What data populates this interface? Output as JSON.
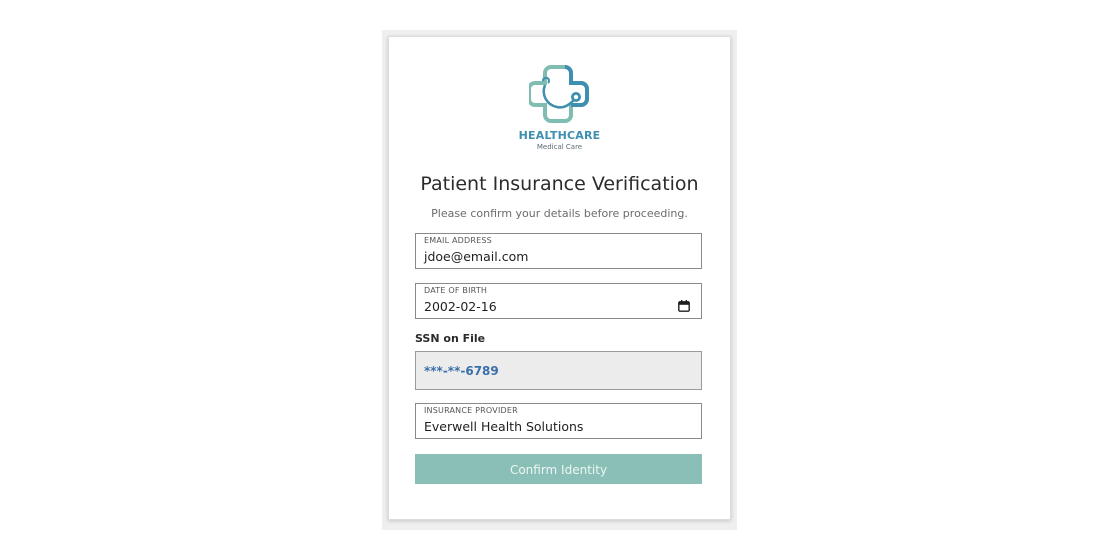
{
  "brand": {
    "name": "HEALTHCARE",
    "tagline": "Medical Care",
    "primary_color": "#3f8fb0",
    "secondary_color": "#7fbdb2",
    "logo_icon": "medical-cross-stethoscope-icon"
  },
  "form": {
    "title": "Patient Insurance Verification",
    "subtitle": "Please confirm your details before proceeding.",
    "email": {
      "label": "EMAIL ADDRESS",
      "value": "jdoe@email.com"
    },
    "dob": {
      "label": "DATE OF BIRTH",
      "value": "2002-02-16",
      "icon": "calendar-icon"
    },
    "ssn": {
      "label": "SSN on File",
      "value": "***-**-6789"
    },
    "insurance": {
      "label": "INSURANCE PROVIDER",
      "value": "Everwell Health Solutions"
    },
    "confirm_label": "Confirm Identity",
    "confirm_color": "#89bfb6"
  }
}
